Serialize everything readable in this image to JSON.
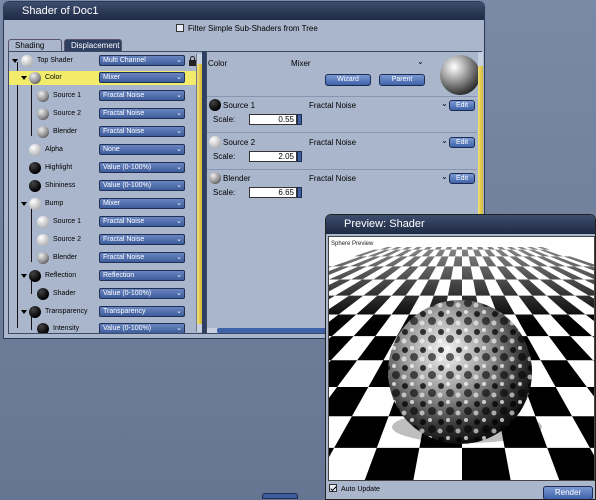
{
  "main_window": {
    "title": "Shader of Doc1",
    "filter_label": "Filter Simple Sub-Shaders from Tree",
    "tabs": [
      "Shading",
      "Displacement"
    ]
  },
  "tree": {
    "nodes": [
      {
        "label": "Top Shader",
        "value": "Multi Channel"
      },
      {
        "label": "Color",
        "value": "Mixer"
      },
      {
        "label": "Source 1",
        "value": "Fractal Noise"
      },
      {
        "label": "Source 2",
        "value": "Fractal Noise"
      },
      {
        "label": "Blender",
        "value": "Fractal Noise"
      },
      {
        "label": "Alpha",
        "value": "None"
      },
      {
        "label": "Highlight",
        "value": "Value (0-100%)"
      },
      {
        "label": "Shininess",
        "value": "Value (0-100%)"
      },
      {
        "label": "Bump",
        "value": "Mixer"
      },
      {
        "label": "Source 1",
        "value": "Fractal Noise"
      },
      {
        "label": "Source 2",
        "value": "Fractal Noise"
      },
      {
        "label": "Blender",
        "value": "Fractal Noise"
      },
      {
        "label": "Reflection",
        "value": "Reflection"
      },
      {
        "label": "Shader",
        "value": "Value (0-100%)"
      },
      {
        "label": "Transparency",
        "value": "Transparency"
      },
      {
        "label": "Intensity",
        "value": "Value (0-100%)"
      }
    ]
  },
  "editor": {
    "channel": "Color",
    "type": "Mixer",
    "wizard": "Wizard",
    "parent": "Parent",
    "sources": [
      {
        "name": "Source 1",
        "type": "Fractal Noise",
        "scale_label": "Scale:",
        "scale": "0.55",
        "edit": "Edit"
      },
      {
        "name": "Source 2",
        "type": "Fractal Noise",
        "scale_label": "Scale:",
        "scale": "2.05",
        "edit": "Edit"
      },
      {
        "name": "Blender",
        "type": "Fractal Noise",
        "scale_label": "Scale:",
        "scale": "6.65",
        "edit": "Edit"
      }
    ]
  },
  "preview": {
    "title": "Preview: Shader",
    "caption": "Sphere Preview",
    "auto_update": "Auto Update",
    "render": "Render"
  },
  "icons": [
    "lock-icon",
    "chevron-down-icon",
    "checkbox-icon"
  ]
}
